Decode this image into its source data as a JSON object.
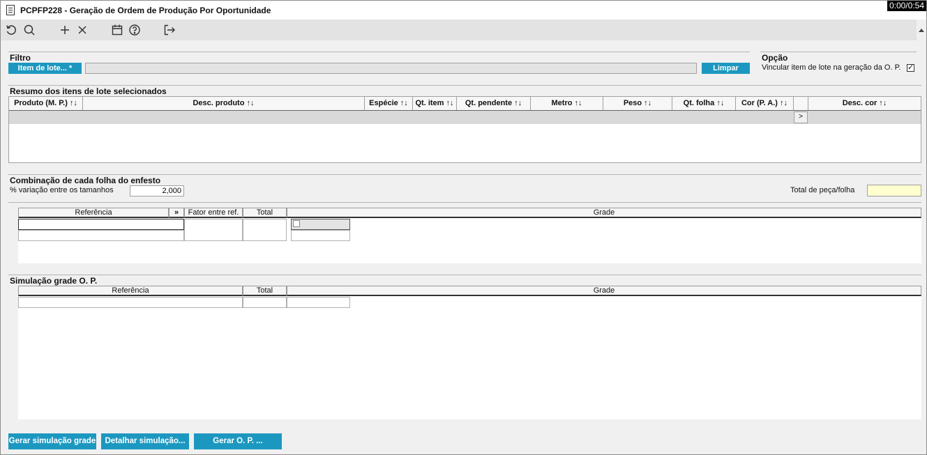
{
  "window": {
    "title": "PCPFP228 - Geração de Ordem de Produção Por Oportunidade",
    "timer": "0:00/0:54"
  },
  "toolbar": {
    "icons": [
      "refresh-icon",
      "search-icon",
      "add-icon",
      "close-icon",
      "calendar-icon",
      "help-icon",
      "exit-icon"
    ]
  },
  "filtro": {
    "title": "Filtro",
    "item_lote_button": "Item de lote... *",
    "item_lote_value": "",
    "limpar_button": "Limpar"
  },
  "opcao": {
    "title": "Opção",
    "vincular_label": "Vincular item de lote na geração da O. P.",
    "vincular_checked": true
  },
  "resumo": {
    "title": "Resumo dos itens de lote selecionados",
    "columns": [
      "Produto (M. P.) ↑↓",
      "Desc. produto ↑↓",
      "Espécie ↑↓",
      "Qt. item ↑↓",
      "Qt. pendente ↑↓",
      "Metro ↑↓",
      "Peso ↑↓",
      "Qt. folha ↑↓",
      "Cor (P. A.) ↑↓",
      "",
      "Desc. cor ↑↓"
    ],
    "row_button": ">"
  },
  "combinacao": {
    "title": "Combinação de cada folha do enfesto",
    "variacao_label": "% variação entre os tamanhos",
    "variacao_value": "2,000",
    "total_label": "Total de peça/folha",
    "total_value": "",
    "columns": {
      "referencia": "Referência",
      "expand": "»",
      "fator": "Fator entre ref.",
      "total": "Total",
      "grade": "Grade"
    }
  },
  "simulacao": {
    "title": "Simulação grade O. P.",
    "columns": {
      "referencia": "Referência",
      "total": "Total",
      "grade": "Grade"
    }
  },
  "footer": {
    "gerar_simulacao": "Gerar simulação grade",
    "detalhar_simulacao": "Detalhar simulação...",
    "gerar_op": "Gerar O. P. ..."
  }
}
